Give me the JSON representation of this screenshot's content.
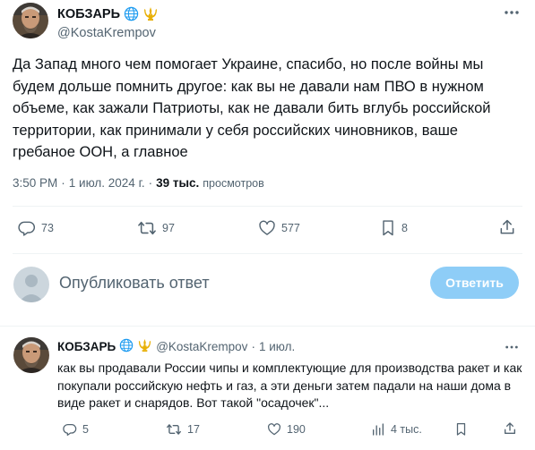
{
  "main": {
    "author_name": "КОБЗАРЬ",
    "handle": "@KostaKrempov",
    "text": "Да Запад много чем помогает Украине, спасибо, но после войны мы будем дольше помнить другое: как вы не давали нам ПВО в нужном объеме, как зажали Патриоты, как не давали бить вглубь российской территории, как принимали у себя российских чиновников, ваше гребаное ООН, а главное",
    "time": "3:50 PM",
    "sep1": "·",
    "date": "1 июл. 2024 г.",
    "sep2": "·",
    "views_count": "39 тыс.",
    "views_label": "просмотров",
    "actions": {
      "replies": "73",
      "reposts": "97",
      "likes": "577",
      "bookmarks": "8"
    }
  },
  "compose": {
    "placeholder": "Опубликовать ответ",
    "button_label": "Ответить"
  },
  "reply": {
    "author_name": "КОБЗАРЬ",
    "handle": "@KostaKrempov",
    "sep": "·",
    "date": "1 июл.",
    "text": "как вы продавали России чипы и комплектующие для производства ракет и как покупали российскую нефть и газ, а эти деньги затем падали на наши дома в виде ракет и снарядов. Вот такой \"осадочек\"...",
    "actions": {
      "replies": "5",
      "reposts": "17",
      "likes": "190",
      "views": "4 тыс."
    }
  },
  "colors": {
    "accent_disabled": "#8ecdf7",
    "muted": "#536471",
    "text": "#0f1419",
    "divider": "#eff3f4"
  },
  "icons": [
    "globe-badge-icon",
    "trident-badge-icon",
    "more-icon",
    "reply-icon",
    "repost-icon",
    "like-icon",
    "bookmark-icon",
    "share-icon",
    "views-icon",
    "default-avatar-icon"
  ]
}
